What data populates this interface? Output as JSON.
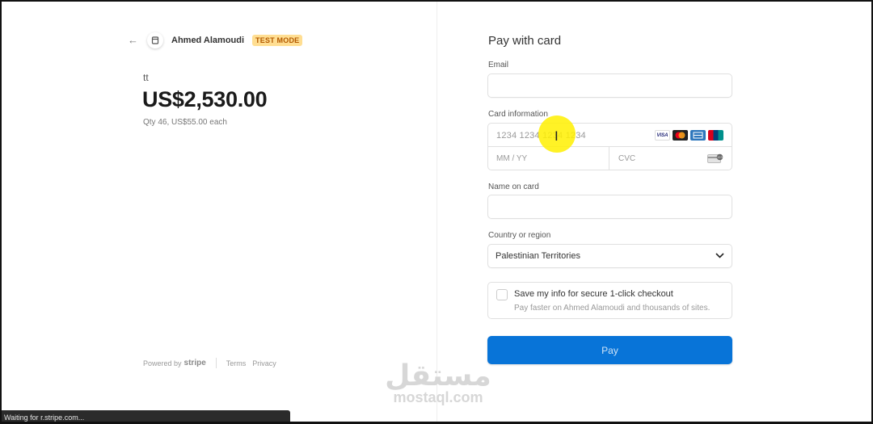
{
  "merchant": {
    "name": "Ahmed Alamoudi",
    "badge": "TEST MODE"
  },
  "product": {
    "name": "tt",
    "price": "US$2,530.00",
    "qty_line": "Qty 46, US$55.00 each"
  },
  "footer": {
    "powered_by": "Powered by",
    "brand": "stripe",
    "terms": "Terms",
    "privacy": "Privacy"
  },
  "form": {
    "title": "Pay with card",
    "email_label": "Email",
    "email_value": "",
    "card_label": "Card information",
    "card_placeholder": "1234 1234 1234 1234",
    "expiry_placeholder": "MM / YY",
    "cvc_placeholder": "CVC",
    "card_brands": [
      "VISA",
      "mastercard",
      "amex",
      "unionpay"
    ],
    "name_label": "Name on card",
    "name_value": "",
    "country_label": "Country or region",
    "country_value": "Palestinian Territories",
    "save_title": "Save my info for secure 1-click checkout",
    "save_sub": "Pay faster on Ahmed Alamoudi and thousands of sites.",
    "save_checked": false,
    "pay_label": "Pay"
  },
  "status_bar": {
    "text": "Waiting for r.stripe.com..."
  },
  "watermark": {
    "arabic": "مستقل",
    "latin": "mostaql.com"
  },
  "colors": {
    "pay_button": "#0874d8",
    "badge_bg": "#ffde92",
    "badge_text": "#b35a00",
    "cursor_highlight": "#fff000"
  }
}
